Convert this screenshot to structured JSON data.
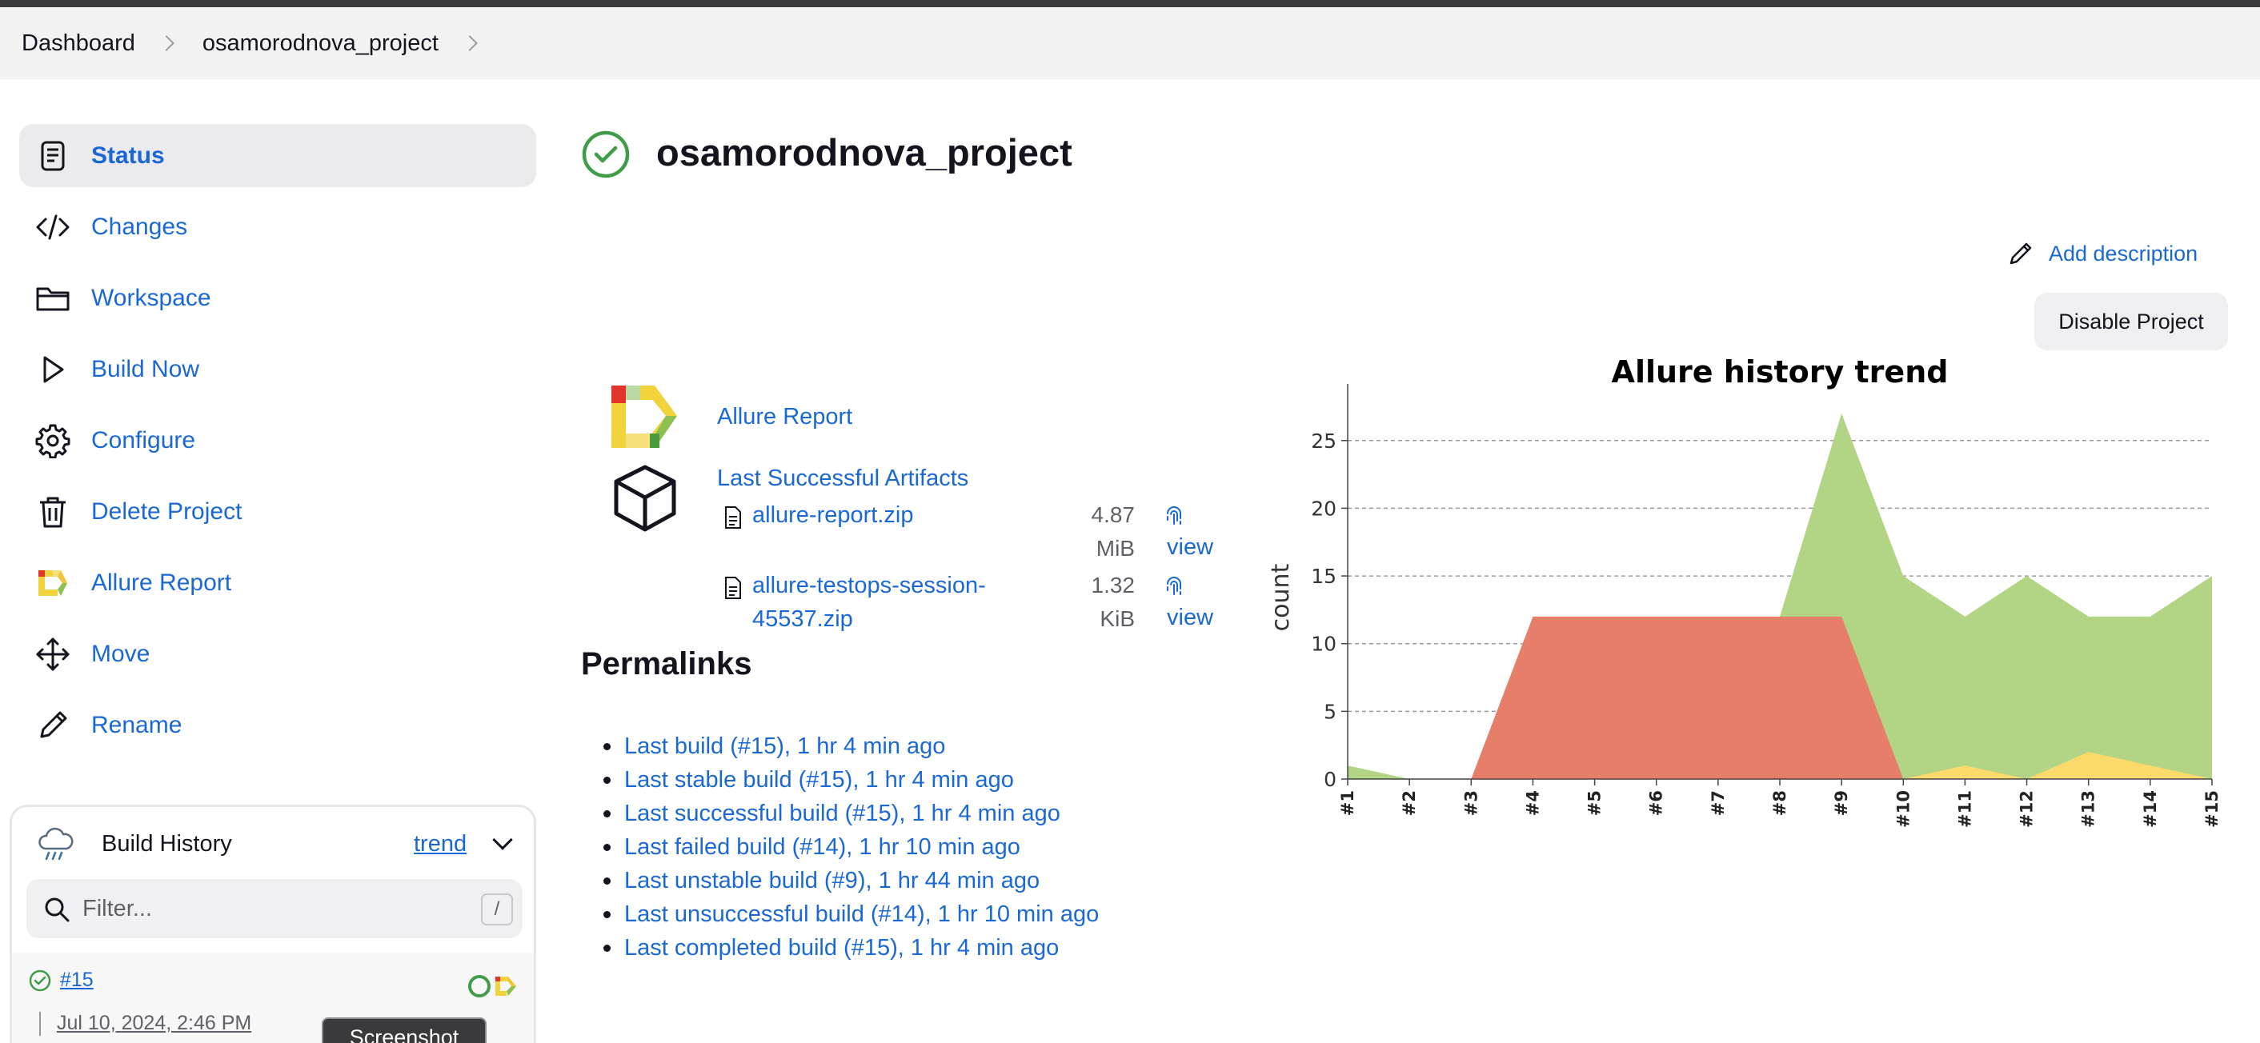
{
  "breadcrumbs": [
    "Dashboard",
    "osamorodnova_project"
  ],
  "sidebar": {
    "items": [
      {
        "label": "Status",
        "icon": "document-icon",
        "active": true
      },
      {
        "label": "Changes",
        "icon": "code-icon"
      },
      {
        "label": "Workspace",
        "icon": "folder-icon"
      },
      {
        "label": "Build Now",
        "icon": "play-icon"
      },
      {
        "label": "Configure",
        "icon": "gear-icon"
      },
      {
        "label": "Delete Project",
        "icon": "trash-icon"
      },
      {
        "label": "Allure Report",
        "icon": "allure-icon"
      },
      {
        "label": "Move",
        "icon": "move-icon"
      },
      {
        "label": "Rename",
        "icon": "pencil-icon"
      }
    ]
  },
  "build_history": {
    "title": "Build History",
    "trend_label": "trend",
    "filter_placeholder": "Filter...",
    "filter_shortcut": "/",
    "builds": [
      {
        "number": "#15",
        "date": "Jul 10, 2024, 2:46 PM",
        "status": "success"
      }
    ],
    "tooltip": "Screenshot"
  },
  "main": {
    "title": "osamorodnova_project",
    "add_description": "Add description",
    "disable_project": "Disable Project",
    "allure_report_link": "Allure Report",
    "last_successful_artifacts": "Last Successful Artifacts",
    "artifacts": [
      {
        "name_lines": [
          "allure-report.zip"
        ],
        "size_lines": [
          "4.87",
          "MiB"
        ],
        "view": "view"
      },
      {
        "name_lines": [
          "allure-testops-session-",
          "45537.zip"
        ],
        "size_lines": [
          "1.32",
          "KiB"
        ],
        "view": "view"
      }
    ],
    "permalinks_title": "Permalinks",
    "permalinks": [
      "Last build (#15), 1 hr 4 min ago",
      "Last stable build (#15), 1 hr 4 min ago",
      "Last successful build (#15), 1 hr 4 min ago",
      "Last failed build (#14), 1 hr 10 min ago",
      "Last unstable build (#9), 1 hr 44 min ago",
      "Last unsuccessful build (#14), 1 hr 10 min ago",
      "Last completed build (#15), 1 hr 4 min ago"
    ]
  },
  "colors": {
    "link": "#1a68d6",
    "success": "#3f9d4a",
    "passed_area": "#b2d585",
    "failed_area": "#e77e6a",
    "broken_area": "#fbd96b"
  },
  "chart_data": {
    "type": "area",
    "title": "Allure history trend",
    "xlabel": "",
    "ylabel": "count",
    "x": [
      "#1",
      "#2",
      "#3",
      "#4",
      "#5",
      "#6",
      "#7",
      "#8",
      "#9",
      "#10",
      "#11",
      "#12",
      "#13",
      "#14",
      "#15"
    ],
    "ylim": [
      0,
      28
    ],
    "yticks": [
      0,
      5,
      10,
      15,
      20,
      25
    ],
    "grid": true,
    "series": [
      {
        "color": "#b2d585",
        "values": [
          1,
          0,
          0,
          0,
          0,
          0,
          0,
          12,
          27,
          15,
          12,
          15,
          12,
          12,
          15
        ]
      },
      {
        "color": "#fbd96b",
        "values": [
          0,
          0,
          0,
          0,
          0,
          0,
          0,
          0,
          0,
          0,
          1,
          0,
          2,
          1,
          0
        ]
      },
      {
        "color": "#e77e6a",
        "values": [
          0,
          0,
          0,
          12,
          12,
          12,
          12,
          12,
          12,
          0,
          0,
          0,
          0,
          0,
          0
        ]
      }
    ]
  }
}
